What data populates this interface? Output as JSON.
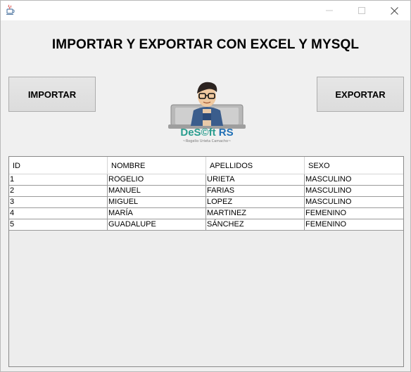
{
  "window": {
    "app_icon": "java-cup-icon",
    "controls": {
      "minimize": "minimize-icon",
      "maximize": "maximize-icon",
      "close": "close-icon"
    }
  },
  "heading": "IMPORTAR Y EXPORTAR CON EXCEL Y MYSQL",
  "buttons": {
    "import": "IMPORTAR",
    "export": "EXPORTAR"
  },
  "logo": {
    "brand_main": "DeS©ft",
    "brand_accent": "RS",
    "tagline": "~Rogelio Urieta Camacho~"
  },
  "table": {
    "columns": [
      "ID",
      "NOMBRE",
      "APELLIDOS",
      "SEXO"
    ],
    "rows": [
      [
        "1",
        "ROGELIO",
        "URIETA",
        "MASCULINO"
      ],
      [
        "2",
        "MANUEL",
        "FARIAS",
        "MASCULINO"
      ],
      [
        "3",
        "MIGUEL",
        "LOPEZ",
        "MASCULINO"
      ],
      [
        "4",
        "MARÍA",
        "MARTINEZ",
        "FEMENINO"
      ],
      [
        "5",
        "GUADALUPE",
        "SÁNCHEZ",
        "FEMENINO"
      ]
    ]
  },
  "colors": {
    "brand_teal": "#2a9d8f",
    "brand_blue": "#1f6fb5",
    "button_bg": "#e1e1e1"
  }
}
